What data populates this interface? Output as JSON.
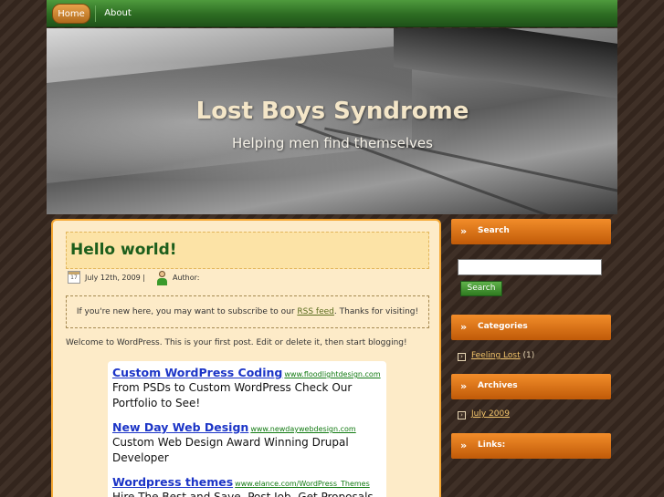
{
  "nav": {
    "items": [
      {
        "label": "Home"
      },
      {
        "label": "About"
      }
    ]
  },
  "header": {
    "title": "Lost Boys Syndrome",
    "description": "Helping men find themselves"
  },
  "post": {
    "title": "Hello world!",
    "calendar_day": "17",
    "date": "July 12th, 2009 |",
    "author_label": "Author:",
    "notice_before": "If you're new here, you may want to subscribe to our ",
    "notice_link": "RSS feed",
    "notice_after": ". Thanks for visiting!",
    "intro": "Welcome to WordPress. This is your first post. Edit or delete it, then start blogging!"
  },
  "ads": [
    {
      "title": "Custom WordPress Coding",
      "url": "www.floodlightdesign.com",
      "text": "From PSDs to Custom WordPress Check Our Portfolio to See!"
    },
    {
      "title": "New Day Web Design",
      "url": "www.newdaywebdesign.com",
      "text": "Custom Web Design Award Winning Drupal Developer"
    },
    {
      "title": "Wordpress themes",
      "url": "www.elance.com/WordPress_Themes",
      "text": "Hire The Best and Save. Post Job, Get Proposals"
    }
  ],
  "sidebar": {
    "search": {
      "heading": "Search",
      "placeholder": "",
      "button": "Search"
    },
    "categories": {
      "heading": "Categories",
      "items": [
        {
          "label": "Feeling Lost",
          "count": "(1)"
        }
      ]
    },
    "archives": {
      "heading": "Archives",
      "items": [
        {
          "label": "July 2009"
        }
      ]
    },
    "links": {
      "heading": "Links:"
    }
  },
  "icons": {
    "chevron": "double-chevron-right-icon",
    "calendar": "calendar-icon",
    "author": "person-icon",
    "arrow": "arrow-right-box-icon"
  },
  "colors": {
    "nav_green": "#2d6c22",
    "accent_orange": "#f28d2a",
    "content_bg": "#fdebc8",
    "post_title": "#1d5e1c",
    "ad_title": "#1c35c7"
  }
}
